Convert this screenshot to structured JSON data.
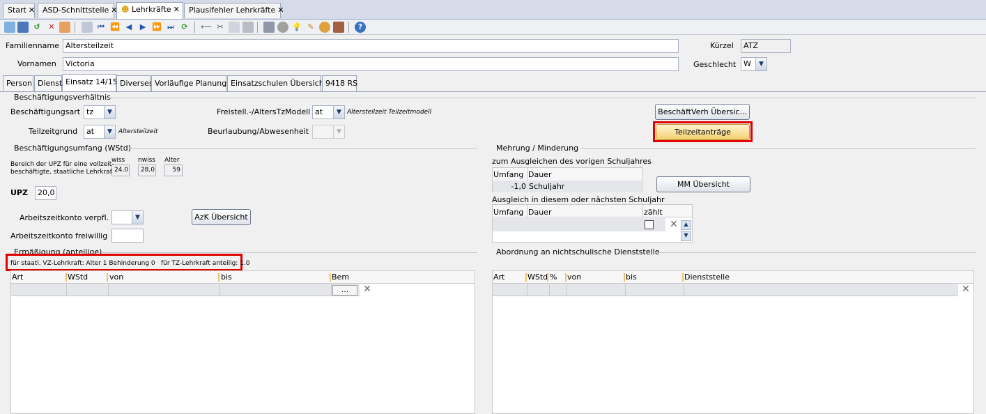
{
  "tabs": [
    {
      "label": "Start"
    },
    {
      "label": "ASD-Schnittstelle"
    },
    {
      "label": "Lehrkräfte"
    },
    {
      "label": "Plausifehler Lehrkräfte"
    }
  ],
  "header": {
    "familienname_label": "Familienname",
    "familienname_value": "Altersteilzeit",
    "vornamen_label": "Vornamen",
    "vornamen_value": "Victoria",
    "kuerzel_label": "Kürzel",
    "kuerzel_value": "ATZ",
    "geschlecht_label": "Geschlecht",
    "geschlecht_value": "W"
  },
  "subtabs": [
    "Person",
    "Dienst",
    "Einsatz 14/15",
    "Diverses",
    "Vorläufige Planung",
    "Einsatzschulen Übersicht",
    "9418 RS"
  ],
  "beschaeftigung": {
    "group_title": "Beschäftigungsverhältnis",
    "art_label": "Beschäftigungsart",
    "art_value": "tz",
    "freistell_label": "Freistell.-/AltersTzModell",
    "freistell_value": "at",
    "freistell_desc": "Altersteilzeit Teilzeitmodell",
    "teilzeitgrund_label": "Teilzeitgrund",
    "teilzeitgrund_value": "at",
    "teilzeitgrund_desc": "Altersteilzeit",
    "beurlaubung_label": "Beurlaubung/Abwesenheit",
    "uebersicht_button": "BeschäftVerh Übersic...",
    "teilzeitantraege_button": "Teilzeitanträge"
  },
  "umfang": {
    "group_title": "Beschäftigungsumfang (WStd)",
    "bereich_text_1": "Bereich der UPZ für eine vollzeit-",
    "bereich_text_2": "beschäftigte, staatliche Lehrkraft",
    "wiss_label": "wiss",
    "wiss_value": "24,0",
    "nwiss_label": "nwiss",
    "nwiss_value": "28,0",
    "alter_label": "Alter",
    "alter_value": "59",
    "upz_label": "UPZ",
    "upz_value": "20,0",
    "azk_verpfl_label": "Arbeitszeitkonto verpfl.",
    "azk_frei_label": "Arbeitszeitkonto freiwillig",
    "azk_button": "AzK Übersicht"
  },
  "mehrung": {
    "group_title": "Mehrung / Minderung",
    "vorjahr_title": "zum Ausgleichen des vorigen Schuljahres",
    "col_umfang": "Umfang",
    "col_dauer": "Dauer",
    "row_umfang": "-1,0",
    "row_dauer": "Schuljahr",
    "mm_button": "MM Übersicht",
    "ausgleich_title": "Ausgleich in diesem oder nächsten Schuljahr",
    "col_zaehlt": "zählt"
  },
  "ermaessigung": {
    "group_title": "Ermäßigung (anteilige)",
    "info_vz": "für staatl. VZ-Lehrkraft: Alter 1 Behinderung 0",
    "info_tz": "für TZ-Lehrkraft anteilig: 1.0",
    "columns": [
      "Art",
      "WStd",
      "von",
      "bis",
      "Bem"
    ],
    "ellipsis": "..."
  },
  "abordnung": {
    "group_title": "Abordnung an nichtschulische Dienststelle",
    "columns": [
      "Art",
      "WStd",
      "%",
      "von",
      "bis",
      "Dienststelle"
    ]
  }
}
